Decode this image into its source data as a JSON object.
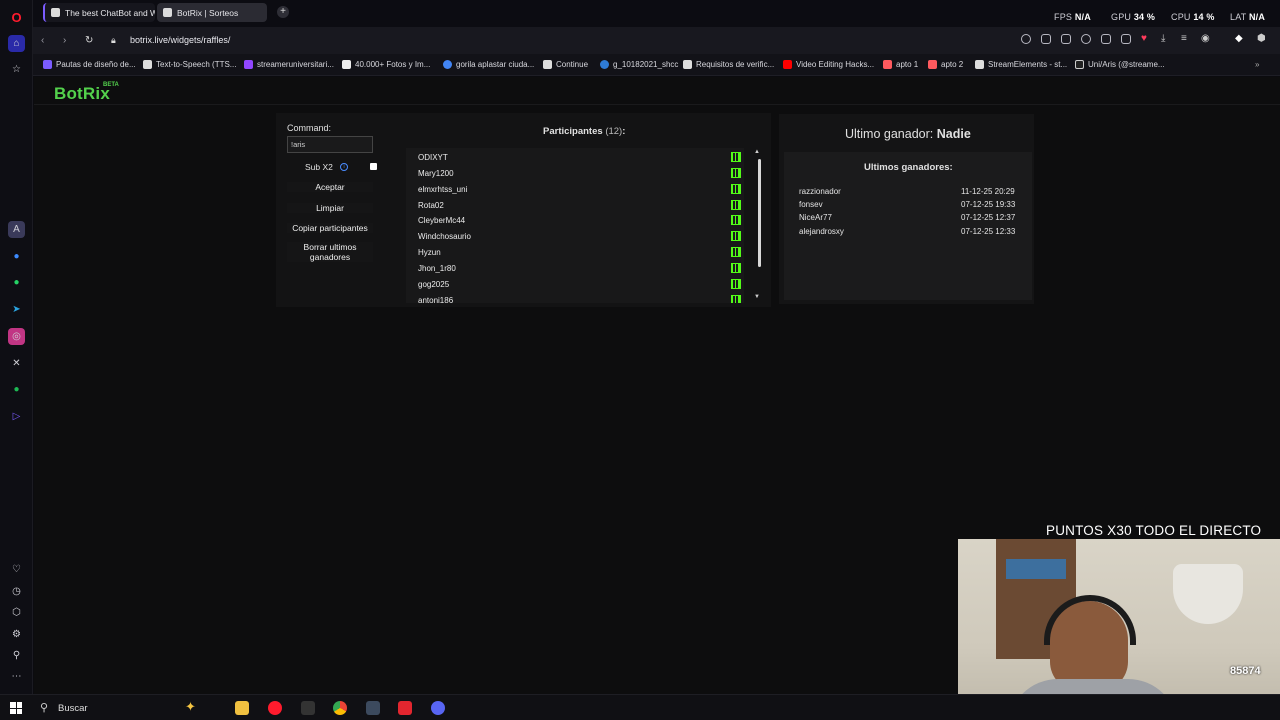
{
  "browser": {
    "tabs": [
      {
        "title": "The best ChatBot and Wi"
      },
      {
        "title": "BotRix | Sorteos"
      }
    ],
    "stats": {
      "fps_label": "FPS",
      "fps_value": "N/A",
      "gpu_label": "GPU",
      "gpu_value": "34 %",
      "cpu_label": "CPU",
      "cpu_value": "14 %",
      "lat_label": "LAT",
      "lat_value": "N/A"
    },
    "url": "botrix.live/widgets/raffles/",
    "bookmarks": [
      "Pautas de diseño de...",
      "Text-to-Speech (TTS...",
      "streameruniversitari...",
      "40.000+ Fotos y Im...",
      "gorila aplastar ciuda...",
      "Continue",
      "g_10182021_shcc",
      "Requisitos de verific...",
      "Video Editing Hacks...",
      "apto 1",
      "apto 2",
      "StreamElements - st...",
      "Uni/Aris (@streame..."
    ]
  },
  "app": {
    "logo": "BotRix",
    "badge": "BETA"
  },
  "controls": {
    "command_label": "Command:",
    "command_value": "!aris",
    "sub_label": "Sub X2",
    "accept": "Aceptar",
    "clear": "Limpiar",
    "copy": "Copiar participantes",
    "delete_line1": "Borrar ultimos",
    "delete_line2": "ganadores"
  },
  "participants": {
    "title": "Participantes",
    "count": "(12)",
    "colon": ":",
    "items": [
      "ODIXYT",
      "Mary1200",
      "elmxrhtss_uni",
      "Rota02",
      "CleyberMc44",
      "Windchosaurio",
      "Hyzun",
      "Jhon_1r80",
      "gog2025",
      "antoni186"
    ]
  },
  "winner": {
    "label": "Ultimo ganador:",
    "name": "Nadie",
    "recent_title": "Ultimos ganadores:",
    "recent": [
      {
        "name": "razzionador",
        "date": "11-12-25 20:29"
      },
      {
        "name": "fonsev",
        "date": "07-12-25 19:33"
      },
      {
        "name": "NiceAr77",
        "date": "07-12-25 12:37"
      },
      {
        "name": "alejandrosxy",
        "date": "07-12-25 12:33"
      }
    ]
  },
  "taskbar": {
    "search": "Buscar"
  },
  "overlay": {
    "title": "PUNTOS X30 TODO EL DIRECTO",
    "points": "85874"
  }
}
